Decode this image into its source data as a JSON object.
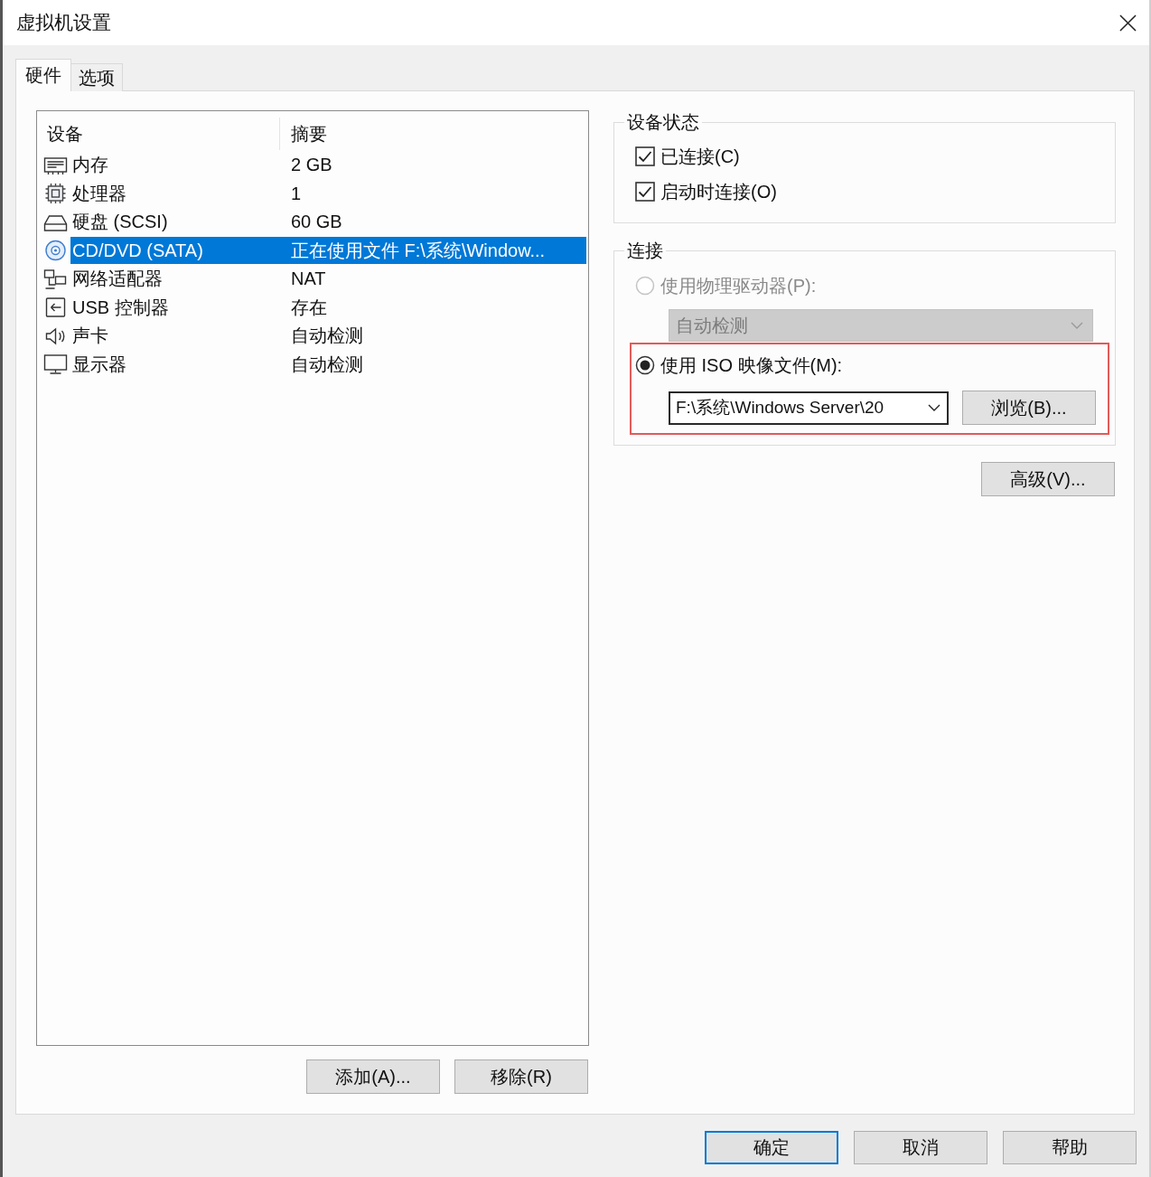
{
  "window": {
    "title": "虚拟机设置"
  },
  "tabs": [
    {
      "label": "硬件",
      "selected": true
    },
    {
      "label": "选项",
      "selected": false
    }
  ],
  "device_table": {
    "columns": [
      "设备",
      "摘要"
    ],
    "rows": [
      {
        "kind": "memory",
        "device": "内存",
        "summary": "2 GB",
        "selected": false
      },
      {
        "kind": "processor",
        "device": "处理器",
        "summary": "1",
        "selected": false
      },
      {
        "kind": "disk",
        "device": "硬盘 (SCSI)",
        "summary": "60 GB",
        "selected": false
      },
      {
        "kind": "cdrom",
        "device": "CD/DVD (SATA)",
        "summary": "正在使用文件 F:\\系统\\Window...",
        "selected": true
      },
      {
        "kind": "network",
        "device": "网络适配器",
        "summary": "NAT",
        "selected": false
      },
      {
        "kind": "usb",
        "device": "USB 控制器",
        "summary": "存在",
        "selected": false
      },
      {
        "kind": "sound",
        "device": "声卡",
        "summary": "自动检测",
        "selected": false
      },
      {
        "kind": "display",
        "device": "显示器",
        "summary": "自动检测",
        "selected": false
      }
    ]
  },
  "list_buttons": [
    "添加(A)...",
    "移除(R)"
  ],
  "device_status": {
    "title": "设备状态",
    "options": [
      {
        "label": "已连接(C)",
        "checked": true
      },
      {
        "label": "启动时连接(O)",
        "checked": true
      }
    ]
  },
  "connection": {
    "title": "连接",
    "options": [
      {
        "kind": "drive",
        "label": "使用物理驱动器(P):",
        "selected": false,
        "disabled": true,
        "highlighted": false,
        "dropdown": "自动检测"
      },
      {
        "kind": "iso",
        "label": "使用 ISO 映像文件(M):",
        "selected": true,
        "disabled": false,
        "highlighted": true,
        "path": "F:\\系统\\Windows Server\\20",
        "browse_button": "浏览(B)..."
      }
    ]
  },
  "advanced_button": "高级(V)...",
  "dialog_buttons": [
    {
      "label": "确定",
      "default": true
    },
    {
      "label": "取消",
      "default": false
    },
    {
      "label": "帮助",
      "default": false
    }
  ]
}
